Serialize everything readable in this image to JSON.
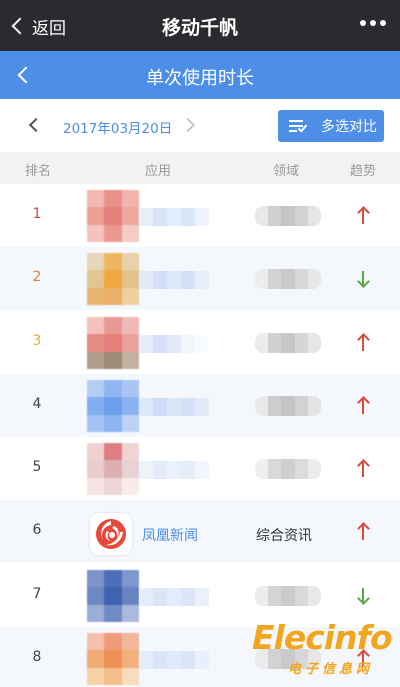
{
  "topbar": {
    "back_label": "返回",
    "title": "移动千帆",
    "more_icon": "more-dots-icon"
  },
  "pagebar": {
    "title": "单次使用时长"
  },
  "date_nav": {
    "date": "2017年03月20日",
    "compare_label": "多选对比"
  },
  "table": {
    "headers": {
      "rank": "排名",
      "app": "应用",
      "field": "领域",
      "trend": "趋势"
    },
    "rows": [
      {
        "rank": "1",
        "trend": "up"
      },
      {
        "rank": "2",
        "trend": "down"
      },
      {
        "rank": "3",
        "trend": "up"
      },
      {
        "rank": "4",
        "trend": "up"
      },
      {
        "rank": "5",
        "trend": "up"
      },
      {
        "rank": "6",
        "app_name": "凤凰新闻",
        "field": "综合资讯",
        "trend": "up"
      },
      {
        "rank": "7",
        "trend": "down"
      },
      {
        "rank": "8",
        "trend": "up"
      }
    ]
  },
  "colors": {
    "accent": "#4d8ee8",
    "up": "#d74a3c",
    "down": "#5aa84a",
    "topbar": "#2b2b2f"
  },
  "watermark": {
    "brand": "Elecinfo",
    "sub": "电子信息网"
  }
}
